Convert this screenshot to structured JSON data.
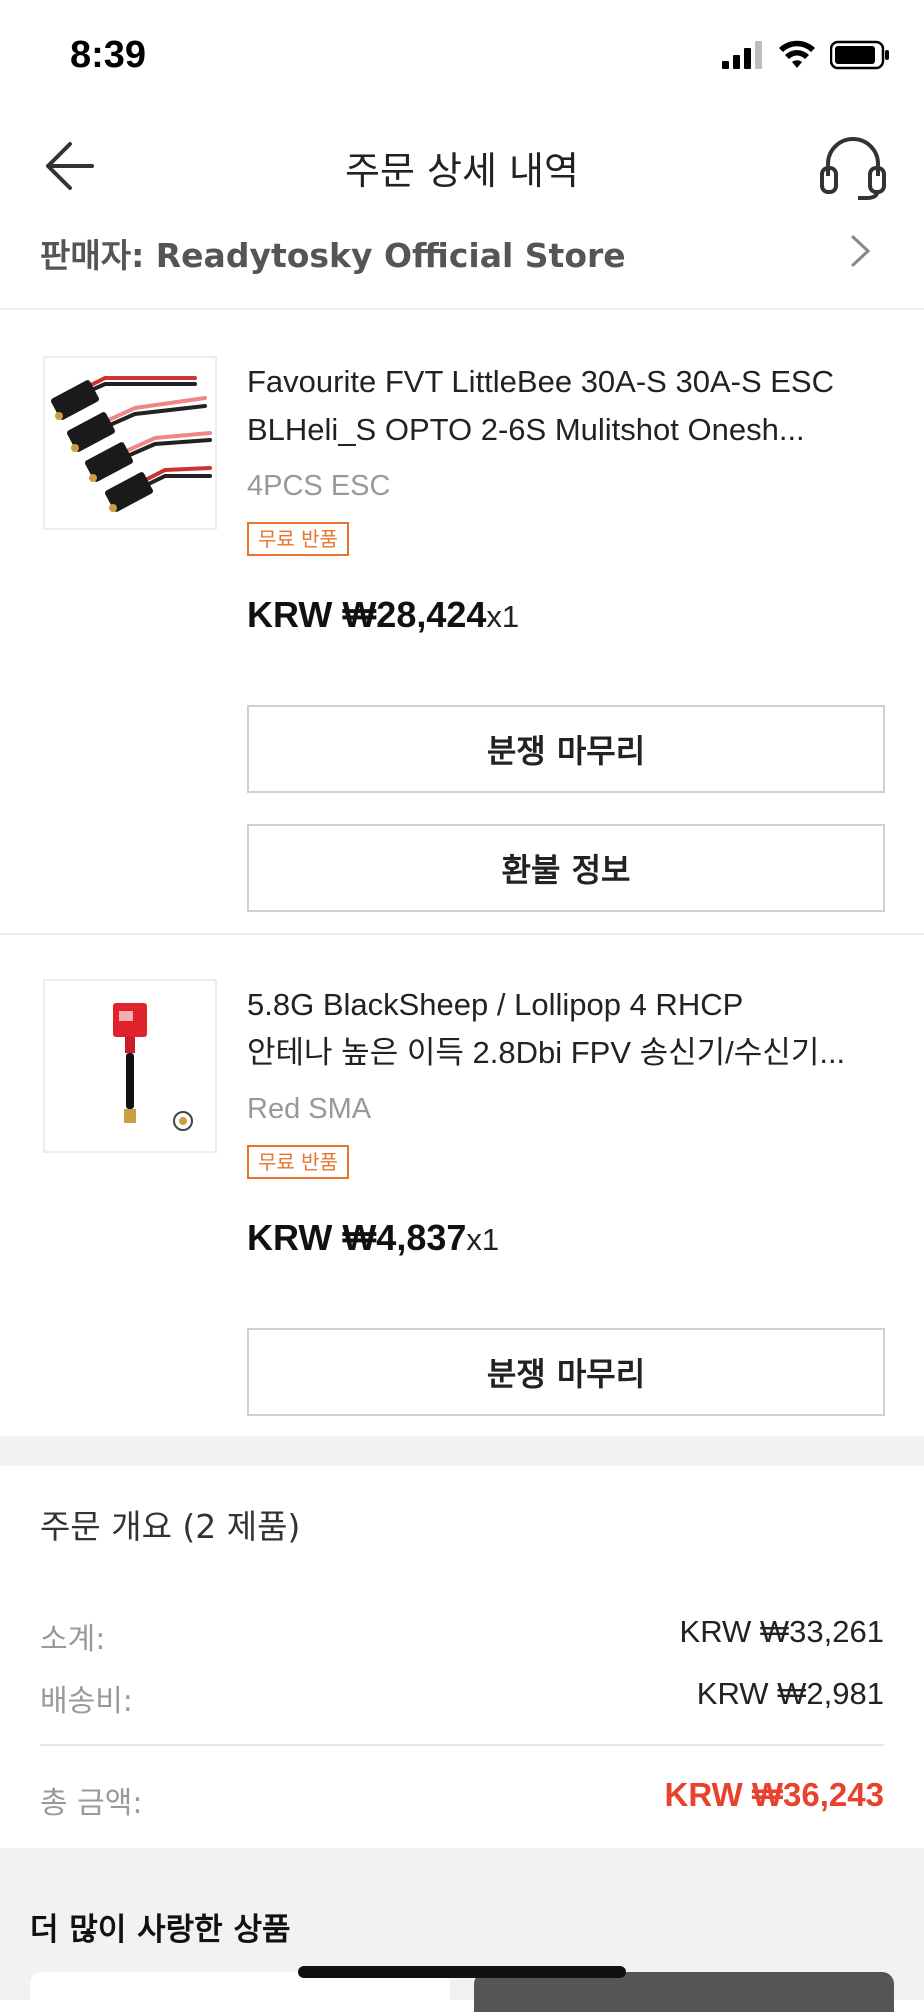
{
  "status": {
    "time": "8:39"
  },
  "header": {
    "title": "주문 상세 내역"
  },
  "seller": {
    "label": "판매자: Readytosky Official Store"
  },
  "products": [
    {
      "title_line1": "Favourite FVT LittleBee 30A-S 30A-S ESC",
      "title_line2": "BLHeli_S OPTO 2-6S Mulitshot Onesh...",
      "variant": "4PCS ESC",
      "badge": "무료 반품",
      "price": "KRW ₩28,424",
      "qty": "x1",
      "buttons": [
        "분쟁 마무리",
        "환불 정보"
      ]
    },
    {
      "title_line1": "5.8G BlackSheep / Lollipop 4 RHCP",
      "title_line2": "안테나 높은 이득 2.8Dbi FPV 송신기/수신기...",
      "variant": "Red SMA",
      "badge": "무료 반품",
      "price": "KRW ₩4,837",
      "qty": "x1",
      "buttons": [
        "분쟁 마무리"
      ]
    }
  ],
  "summary": {
    "title": "주문 개요 (2 제품)",
    "subtotal_label": "소계:",
    "subtotal_value": "KRW ₩33,261",
    "shipping_label": "배송비:",
    "shipping_value": "KRW ₩2,981",
    "total_label": "총 금액:",
    "total_value": "KRW ₩36,243"
  },
  "recommend": {
    "title": "더 많이 사랑한 상품"
  },
  "colors": {
    "accent_orange": "#e8742c",
    "total_red": "#e8412c"
  }
}
